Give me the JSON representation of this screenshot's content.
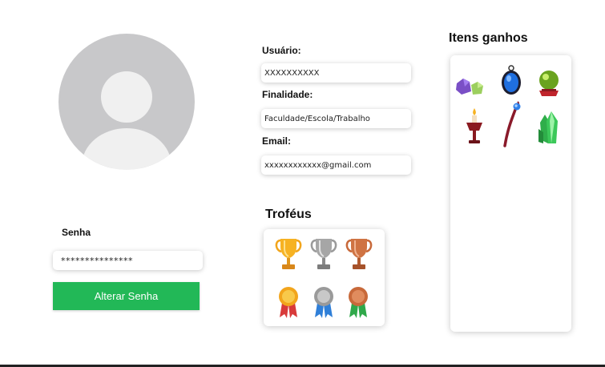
{
  "profile": {
    "avatar_icon": "user-avatar-icon"
  },
  "password": {
    "label": "Senha",
    "value": "***************",
    "button_label": "Alterar Senha"
  },
  "fields": {
    "user_label": "Usuário:",
    "user_value": "XXXXXXXXXX",
    "purpose_label": "Finalidade:",
    "purpose_value": "Faculdade/Escola/Trabalho",
    "email_label": "Email:",
    "email_value": "xxxxxxxxxxxx@gmail.com"
  },
  "trophies": {
    "title": "Troféus",
    "items": [
      "gold-trophy-icon",
      "silver-trophy-icon",
      "bronze-trophy-icon",
      "gold-medal-icon",
      "silver-medal-icon",
      "bronze-medal-icon"
    ]
  },
  "items_panel": {
    "title": "Itens ganhos",
    "items": [
      "crystals-icon",
      "mirror-amulet-icon",
      "crystal-ball-icon",
      "candle-goblet-icon",
      "magic-staff-icon",
      "green-crystal-icon"
    ]
  },
  "colors": {
    "accent": "#22b857",
    "avatar_bg": "#c8c8ca",
    "gold": "#f2a51c",
    "silver": "#9a9a9a",
    "bronze": "#c8693a"
  }
}
